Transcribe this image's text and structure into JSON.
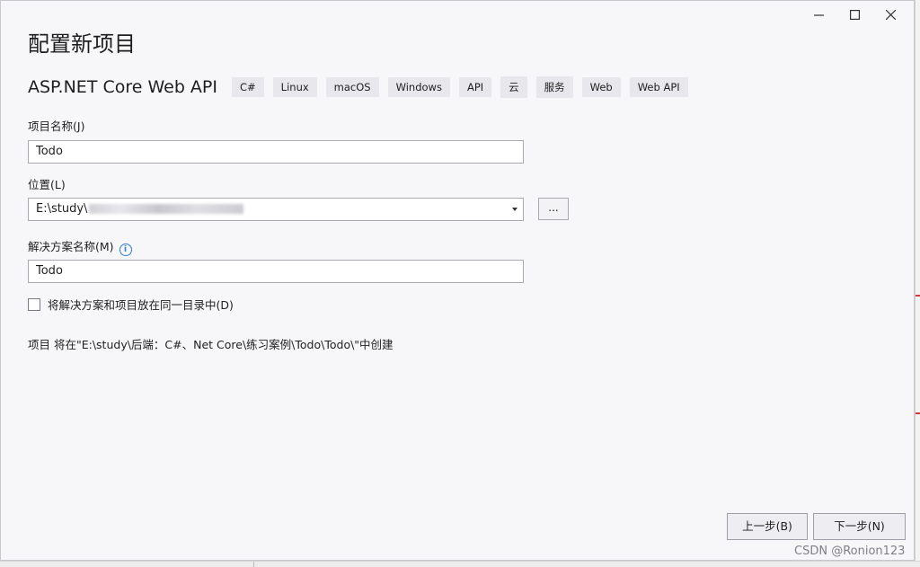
{
  "dialog": {
    "title": "配置新项目",
    "template_name": "ASP.NET Core Web API",
    "tags": [
      "C#",
      "Linux",
      "macOS",
      "Windows",
      "API",
      "云",
      "服务",
      "Web",
      "Web API"
    ]
  },
  "form": {
    "project_name_label": "项目名称(J)",
    "project_name_value": "Todo",
    "location_label": "位置(L)",
    "location_value": "E:\\study\\",
    "browse_label": "...",
    "solution_name_label": "解决方案名称(M)",
    "solution_name_value": "Todo",
    "same_dir_label": "将解决方案和项目放在同一目录中(D)",
    "same_dir_checked": false,
    "location_note": "项目 将在\"E:\\study\\后端：C#、Net Core\\练习案例\\Todo\\Todo\\\"中创建"
  },
  "buttons": {
    "back": "上一步(B)",
    "next": "下一步(N)"
  },
  "window_controls": [
    "minimize-icon",
    "maximize-icon",
    "close-icon"
  ],
  "watermark": "CSDN @Ronion123"
}
